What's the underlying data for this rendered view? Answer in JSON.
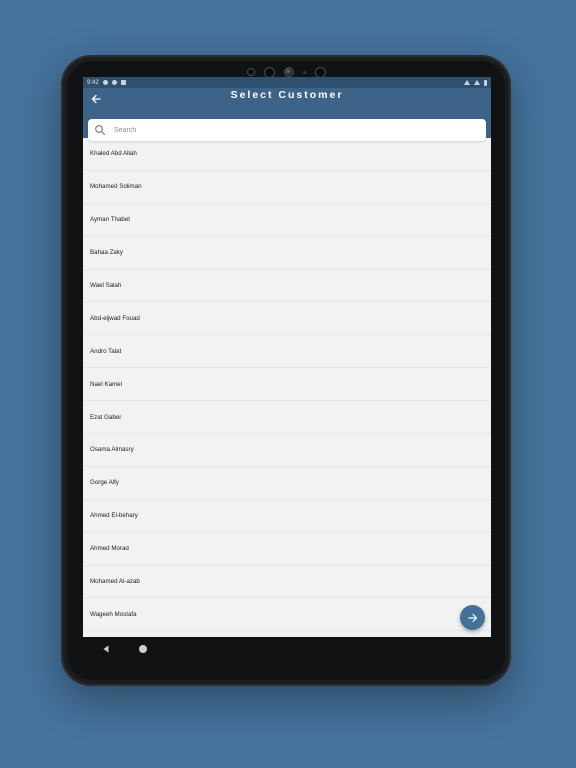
{
  "app": {
    "title": "Select Customer"
  },
  "status_bar": {
    "time": "9:42"
  },
  "search": {
    "placeholder": "Search",
    "value": ""
  },
  "customers": [
    "Khaled Abd Allah",
    "Mohamed Soliman",
    "Ayman Thabet",
    "Bahaa Zaky",
    "Wael Salah",
    "Abd-eljwad Fouad",
    "Andro Talat",
    "Nael Kamel",
    "Ezat Gaber",
    "Osama Almasry",
    "Gorge Alfy",
    "Ahmed El-behary",
    "Ahmed Morad",
    "Mohamed Al-azab",
    "Wageeh Mostafa"
  ],
  "icons": {
    "back": "arrow-left-icon",
    "search": "search-icon",
    "fab": "arrow-right-icon",
    "nav_back": "triangle-back-icon",
    "nav_home": "circle-home-icon"
  },
  "colors": {
    "background": "#46729c",
    "appbar": "#3d6389",
    "statusbar": "#30506f",
    "fab": "#44709c",
    "list_bg": "#f2f2f2"
  }
}
